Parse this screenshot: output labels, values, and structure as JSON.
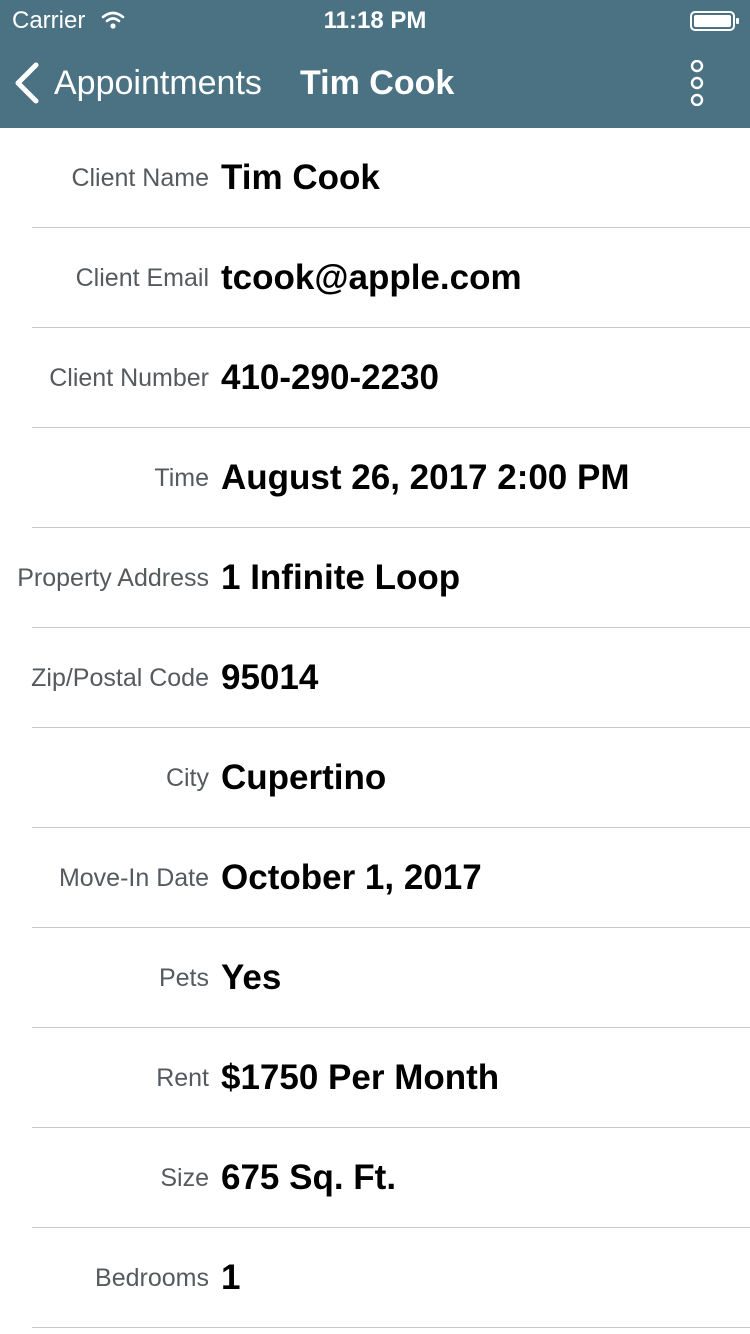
{
  "status_bar": {
    "carrier": "Carrier",
    "time": "11:18 PM"
  },
  "nav": {
    "back_label": "Appointments",
    "title": "Tim Cook",
    "back_icon": "chevron-left-icon",
    "more_icon": "more-vertical-icon"
  },
  "colors": {
    "header_bg": "#4a7283",
    "label_text": "#555a5e",
    "value_text": "#000000",
    "divider": "#c8c8cc"
  },
  "details": [
    {
      "label": "Client Name",
      "value": "Tim Cook"
    },
    {
      "label": "Client Email",
      "value": "tcook@apple.com"
    },
    {
      "label": "Client Number",
      "value": "410-290-2230"
    },
    {
      "label": "Time",
      "value": "August 26, 2017 2:00 PM"
    },
    {
      "label": "Property Address",
      "value": "1 Infinite Loop"
    },
    {
      "label": "Zip/Postal Code",
      "value": "95014"
    },
    {
      "label": "City",
      "value": "Cupertino"
    },
    {
      "label": "Move-In Date",
      "value": "October 1, 2017"
    },
    {
      "label": "Pets",
      "value": "Yes"
    },
    {
      "label": "Rent",
      "value": "$1750 Per Month"
    },
    {
      "label": "Size",
      "value": "675 Sq. Ft."
    },
    {
      "label": "Bedrooms",
      "value": "1"
    }
  ]
}
